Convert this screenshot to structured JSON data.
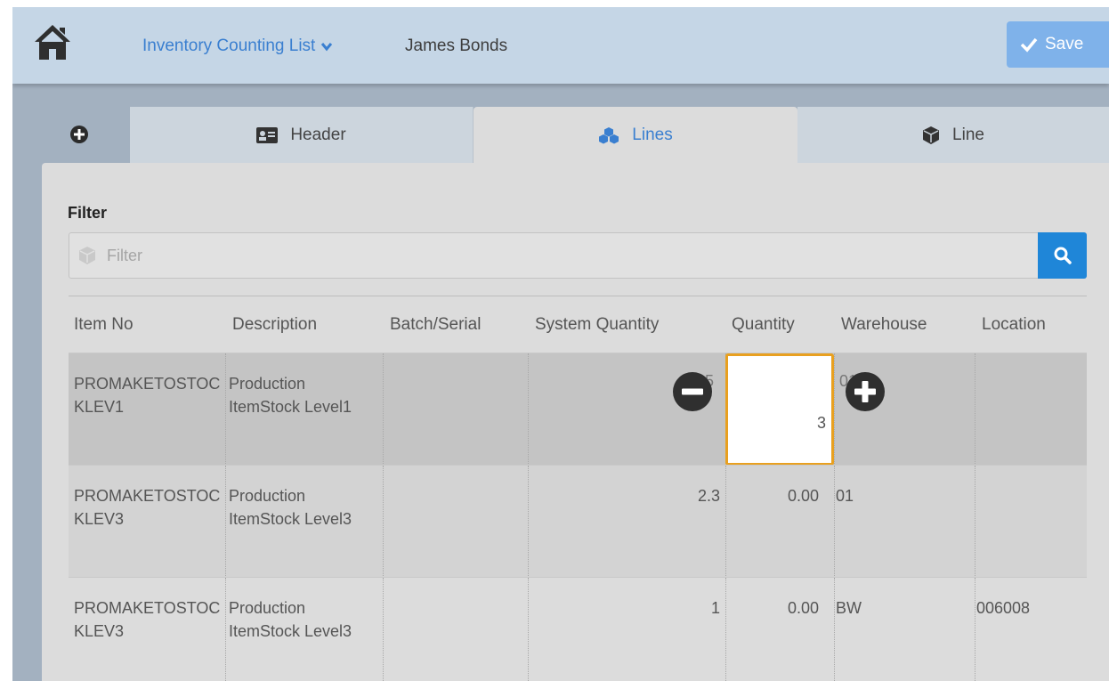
{
  "header": {
    "app_title": "Inventory Counting List",
    "user_name": "James Bonds",
    "save_label": "Save"
  },
  "tabs": [
    {
      "label": "Header",
      "icon": "id-card-icon"
    },
    {
      "label": "Lines",
      "icon": "cubes-icon",
      "active": true
    },
    {
      "label": "Line",
      "icon": "cube-icon"
    }
  ],
  "filter": {
    "label": "Filter",
    "placeholder": "Filter"
  },
  "table": {
    "columns": [
      "Item No",
      "Description",
      "Batch/Serial",
      "System Quantity",
      "Quantity",
      "Warehouse",
      "Location"
    ],
    "rows": [
      {
        "item_no": "PROMAKETOSTOCKLEV1",
        "description": "Production ItemStock Level1",
        "batch": "",
        "system_qty": "2.5",
        "quantity": "3",
        "warehouse": "01",
        "location": ""
      },
      {
        "item_no": "PROMAKETOSTOCKLEV3",
        "description": "Production ItemStock Level3",
        "batch": "",
        "system_qty": "2.3",
        "quantity": "0.00",
        "warehouse": "01",
        "location": ""
      },
      {
        "item_no": "PROMAKETOSTOCKLEV3",
        "description": "Production ItemStock Level3",
        "batch": "",
        "system_qty": "1",
        "quantity": "0.00",
        "warehouse": "BW",
        "location": "006008"
      }
    ]
  },
  "colors": {
    "accent": "#3a7fd0",
    "search_button": "#1f86d8",
    "save_button": "#7fb2ea",
    "focus_border": "#e8a020"
  }
}
